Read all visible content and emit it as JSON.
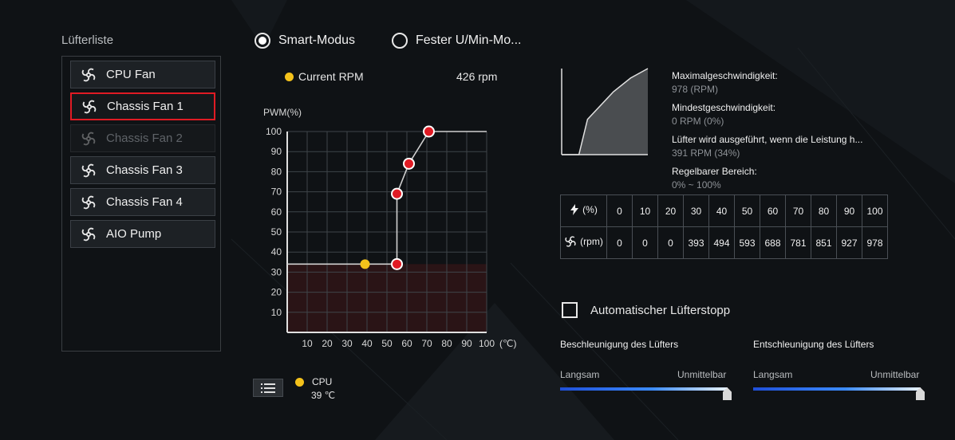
{
  "fan_list": {
    "title": "Lüfterliste",
    "items": [
      {
        "label": "CPU Fan",
        "state": "normal"
      },
      {
        "label": "Chassis Fan 1",
        "state": "selected"
      },
      {
        "label": "Chassis Fan 2",
        "state": "disabled"
      },
      {
        "label": "Chassis Fan 3",
        "state": "normal"
      },
      {
        "label": "Chassis Fan 4",
        "state": "normal"
      },
      {
        "label": "AIO Pump",
        "state": "normal"
      }
    ]
  },
  "modes": {
    "smart": {
      "label": "Smart-Modus",
      "selected": true
    },
    "fixed": {
      "label": "Fester U/Min-Mo...",
      "selected": false
    }
  },
  "current_rpm": {
    "label": "Current RPM",
    "value": "426 rpm"
  },
  "chart_data": {
    "type": "line",
    "ylabel": "PWM(%)",
    "xunit": "(℃)",
    "xticks": [
      10,
      20,
      30,
      40,
      50,
      60,
      70,
      80,
      90,
      100
    ],
    "yticks": [
      10,
      20,
      30,
      40,
      50,
      60,
      70,
      80,
      90,
      100
    ],
    "xlim": [
      0,
      100
    ],
    "ylim": [
      0,
      100
    ],
    "series": [
      {
        "points": [
          [
            0,
            34
          ],
          [
            55,
            34
          ],
          [
            55,
            69
          ],
          [
            61,
            84
          ],
          [
            71,
            100
          ],
          [
            100,
            100
          ]
        ],
        "control_points": [
          [
            55,
            34
          ],
          [
            55,
            69
          ],
          [
            61,
            84
          ],
          [
            71,
            100
          ]
        ]
      }
    ],
    "current_point": [
      39,
      34
    ],
    "min_region_y": 34,
    "colors": {
      "curve": "#d0d0d0",
      "control": "#e01b24",
      "current": "#f4c21b",
      "region": "#2a1416"
    }
  },
  "cpu_legend": {
    "label": "CPU",
    "value": "39 ℃"
  },
  "mini_chart": {
    "type": "area",
    "xlim": [
      0,
      100
    ],
    "ylim": [
      0,
      100
    ],
    "points": [
      [
        0,
        0
      ],
      [
        20,
        0
      ],
      [
        30,
        41
      ],
      [
        60,
        73
      ],
      [
        80,
        89
      ],
      [
        100,
        100
      ]
    ]
  },
  "fan_info": [
    {
      "key": "Maximalgeschwindigkeit:",
      "value": "978 (RPM)"
    },
    {
      "key": "Mindestgeschwindigkeit:",
      "value": "0 RPM (0%)"
    },
    {
      "key": "Lüfter wird ausgeführt, wenn die Leistung h...",
      "value": "391 RPM (34%)"
    },
    {
      "key": "Regelbarer Bereich:",
      "value": "0% ~ 100%"
    }
  ],
  "rpm_table": {
    "percent_label": "(%)",
    "rpm_label": "(rpm)",
    "percent": [
      "0",
      "10",
      "20",
      "30",
      "40",
      "50",
      "60",
      "70",
      "80",
      "90",
      "100"
    ],
    "rpm": [
      "0",
      "0",
      "0",
      "393",
      "494",
      "593",
      "688",
      "781",
      "851",
      "927",
      "978"
    ]
  },
  "auto_stop": {
    "label": "Automatischer Lüfterstopp",
    "checked": false
  },
  "sliders": {
    "accel": {
      "title": "Beschleunigung des Lüfters",
      "left": "Langsam",
      "right": "Unmittelbar",
      "value": 1.0
    },
    "decel": {
      "title": "Entschleunigung des Lüfters",
      "left": "Langsam",
      "right": "Unmittelbar",
      "value": 1.0
    }
  }
}
